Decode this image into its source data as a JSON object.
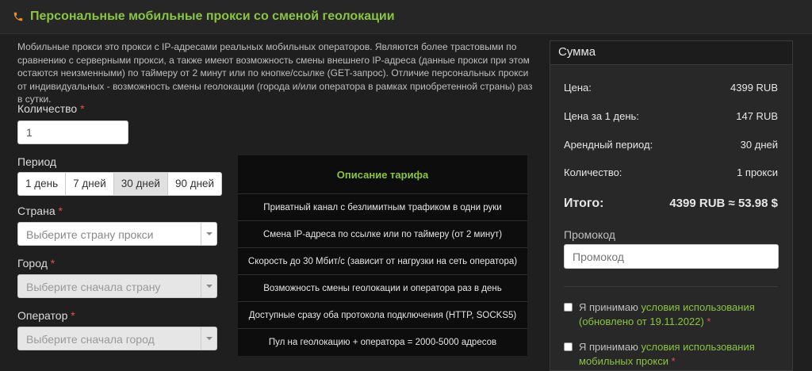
{
  "header": {
    "title": "Персональные мобильные прокси со сменой геолокации",
    "icon": "phone-icon",
    "accent": "#8ac53f"
  },
  "intro": "Мобильные прокси это прокси с IP-адресами реальных мобильных операторов. Являются более трастовыми по сравнению с серверными прокси, а также имеют возможность смены внешнего IP-адреса (данные прокси при этом остаются неизменными) по таймеру от 2 минут или по кнопке/ссылке (GET-запрос). Отличие персональных прокси от индивидуальных - возможность смены геолокации (города и/или оператора в рамках приобретенной страны) раз в сутки.",
  "form": {
    "quantity": {
      "label": "Количество",
      "required": "*",
      "value": "1"
    },
    "period": {
      "label": "Период",
      "options": [
        "1 день",
        "7 дней",
        "30 дней",
        "90 дней"
      ],
      "selected": "30 дней"
    },
    "country": {
      "label": "Страна",
      "required": "*",
      "placeholder": "Выберите страну прокси"
    },
    "city": {
      "label": "Город",
      "required": "*",
      "placeholder": "Выберите сначала страну"
    },
    "operator": {
      "label": "Оператор",
      "required": "*",
      "placeholder": "Выберите сначала город"
    }
  },
  "tariff": {
    "title": "Описание тарифа",
    "rows": [
      "Приватный канал с безлимитным трафиком в одни руки",
      "Смена IP-адреса по ссылке или по таймеру (от 2 минут)",
      "Скорость до 30 Мбит/с (зависит от нагрузки на сеть оператора)",
      "Возможность смены геолокации и оператора раз в день",
      "Доступные сразу оба протокола подключения (HTTP, SOCKS5)",
      "Пул на геолокацию + оператора = 2000-5000 адресов"
    ]
  },
  "summary": {
    "title": "Сумма",
    "price": {
      "label": "Цена:",
      "value": "4399 RUB"
    },
    "per_day": {
      "label": "Цена за 1 день:",
      "value": "147 RUB"
    },
    "rent": {
      "label": "Арендный период:",
      "value": "30 дней"
    },
    "qty": {
      "label": "Количество:",
      "value": "1 прокси"
    },
    "total": {
      "label": "Итого:",
      "value": "4399 RUB ≈ 53.98 $"
    },
    "promo": {
      "label": "Промокод",
      "placeholder": "Промокод"
    },
    "terms1": {
      "prefix": "Я принимаю ",
      "link": "условия использования (обновлено от 19.11.2022)",
      "required": "*"
    },
    "terms2": {
      "prefix": "Я принимаю ",
      "link": "условия использования мобильных прокси",
      "required": "*"
    }
  }
}
